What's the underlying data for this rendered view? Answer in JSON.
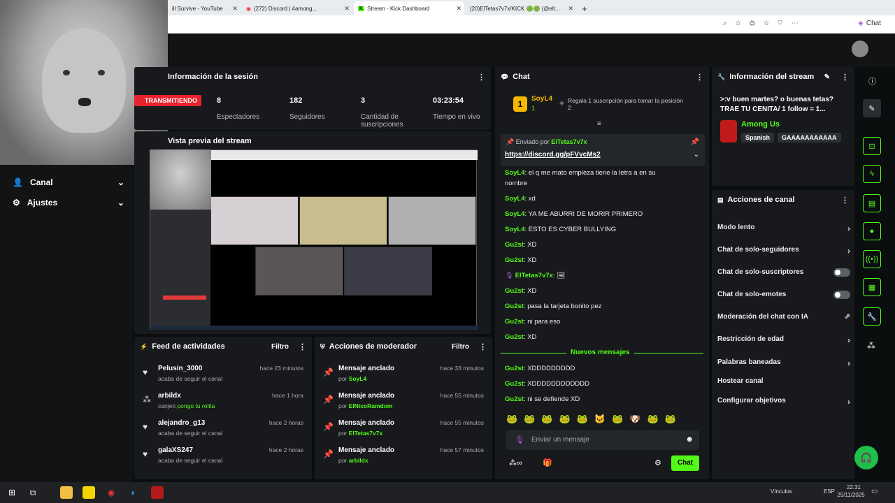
{
  "browser": {
    "tabs": [
      {
        "label": "ill Survive - YouTube"
      },
      {
        "label": "(272) Discord | #among..."
      },
      {
        "label": "Stream - Kick Dashboard"
      },
      {
        "label": "(20)ElTetas7v7x/KICK 🟢🟢 (@elt..."
      }
    ],
    "new_tab": "+",
    "chat_button": "Chat"
  },
  "session": {
    "title": "Información de la sesión",
    "live_badge": "TRANSMITIENDO",
    "stats": [
      {
        "value": "8",
        "label": "Espectadores"
      },
      {
        "value": "182",
        "label": "Seguidores"
      },
      {
        "value": "3",
        "label": "Cantidad de suscripciones"
      },
      {
        "value": "03:23:54",
        "label": "Tiempo en vivo"
      }
    ]
  },
  "preview": {
    "title": "Vista previa del stream"
  },
  "sidebar": {
    "items": [
      {
        "label": "Canal"
      },
      {
        "label": "Ajustes"
      }
    ]
  },
  "feed": {
    "title": "Feed de actividades",
    "filter": "Filtro",
    "items": [
      {
        "name": "Pelusin_3000",
        "sub": "acaba de seguir el canal",
        "time": "hace 23 minutos",
        "extra": ""
      },
      {
        "name": "arbildx",
        "sub": "canjeó",
        "time": "hace 1 hora",
        "extra": "pongo tu rolita"
      },
      {
        "name": "alejandro_g13",
        "sub": "acaba de seguir el canal",
        "time": "hace 2 horas",
        "extra": ""
      },
      {
        "name": "galaXS247",
        "sub": "acaba de seguir el canal",
        "time": "hace 2 horas",
        "extra": ""
      }
    ]
  },
  "mod": {
    "title": "Acciones de moderador",
    "filter": "Filtro",
    "items": [
      {
        "name": "Mensaje anclado",
        "by": "por",
        "user": "SoyL4",
        "time": "hace 33 minutos"
      },
      {
        "name": "Mensaje anclado",
        "by": "por",
        "user": "ElNicoRamdom",
        "time": "hace 55 minutos"
      },
      {
        "name": "Mensaje anclado",
        "by": "por",
        "user": "ElTetas7v7x",
        "time": "hace 55 minutos"
      },
      {
        "name": "Mensaje anclado",
        "by": "por",
        "user": "arbildx",
        "time": "hace 57 minutos"
      }
    ]
  },
  "chat": {
    "title": "Chat",
    "top_gifter": {
      "rank": "1",
      "name": "SoyL4",
      "count": "1"
    },
    "gift_prompt": "Regala 1 suscripción para tomar la posición 2",
    "pinned": {
      "by_label": "Enviado por",
      "user": "ElTetas7v7x",
      "link": "https://discord.gg/pFVvcMs2"
    },
    "messages": [
      {
        "user": "SoyL4",
        "text": "el q me mato empieza tiene la letra a en su"
      },
      {
        "user": "",
        "text": "nombre"
      },
      {
        "user": "SoyL4",
        "text": "xd"
      },
      {
        "user": "SoyL4",
        "text": "YA ME ABURRI DE MORIR PRIMERO"
      },
      {
        "user": "SoyL4",
        "text": "ESTO ES CYBER BULLYING"
      },
      {
        "user": "Gu2st",
        "text": "XD"
      },
      {
        "user": "Gu2st",
        "text": "XD"
      },
      {
        "user": "ElTetas7v7x",
        "text": ""
      },
      {
        "user": "Gu2st",
        "text": "XD"
      },
      {
        "user": "Gu2st",
        "text": "pasa la tarjeta bonito pez"
      },
      {
        "user": "Gu2st",
        "text": "ni para eso"
      },
      {
        "user": "Gu2st",
        "text": "XD"
      }
    ],
    "new_messages_label": "Nuevos mensajes",
    "new_messages": [
      {
        "user": "Gu2st",
        "text": "XDDDDDDDDD"
      },
      {
        "user": "Gu2st",
        "text": "XDDDDDDDDDDDD"
      },
      {
        "user": "Gu2st",
        "text": "ni se defiende XD"
      }
    ],
    "input_placeholder": "Enviar un mensaje",
    "send_label": "Chat"
  },
  "stream_info": {
    "title": "Información del stream",
    "stream_title": ">:v buen martes? o buenas tetas? TRAE TU CENITA/ 1 follow = 1...",
    "category": "Among Us",
    "tags": [
      "Spanish",
      "GAAAAAAAAAAA"
    ]
  },
  "actions": {
    "title": "Acciones de canal",
    "items": [
      {
        "label": "Modo lento",
        "kind": "arrow"
      },
      {
        "label": "Chat de solo-seguidores",
        "kind": "arrow"
      },
      {
        "label": "Chat de solo-suscriptores",
        "kind": "toggle"
      },
      {
        "label": "Chat de solo-emotes",
        "kind": "toggle"
      },
      {
        "label": "Moderación del chat con IA",
        "kind": "external"
      },
      {
        "label": "Restricción de edad",
        "kind": "arrow"
      },
      {
        "label": "Palabras baneadas",
        "kind": "arrow"
      },
      {
        "label": "Hostear canal",
        "kind": "none"
      },
      {
        "label": "Configurar objetivos",
        "kind": "arrow"
      }
    ]
  },
  "taskbar": {
    "tray_label": "Vínculos",
    "lang": "ESP",
    "time": "22:31",
    "date": "25/11/2025"
  },
  "colors": {
    "accent": "#53fc18",
    "live": "#e8232d",
    "panel": "#17191c"
  }
}
